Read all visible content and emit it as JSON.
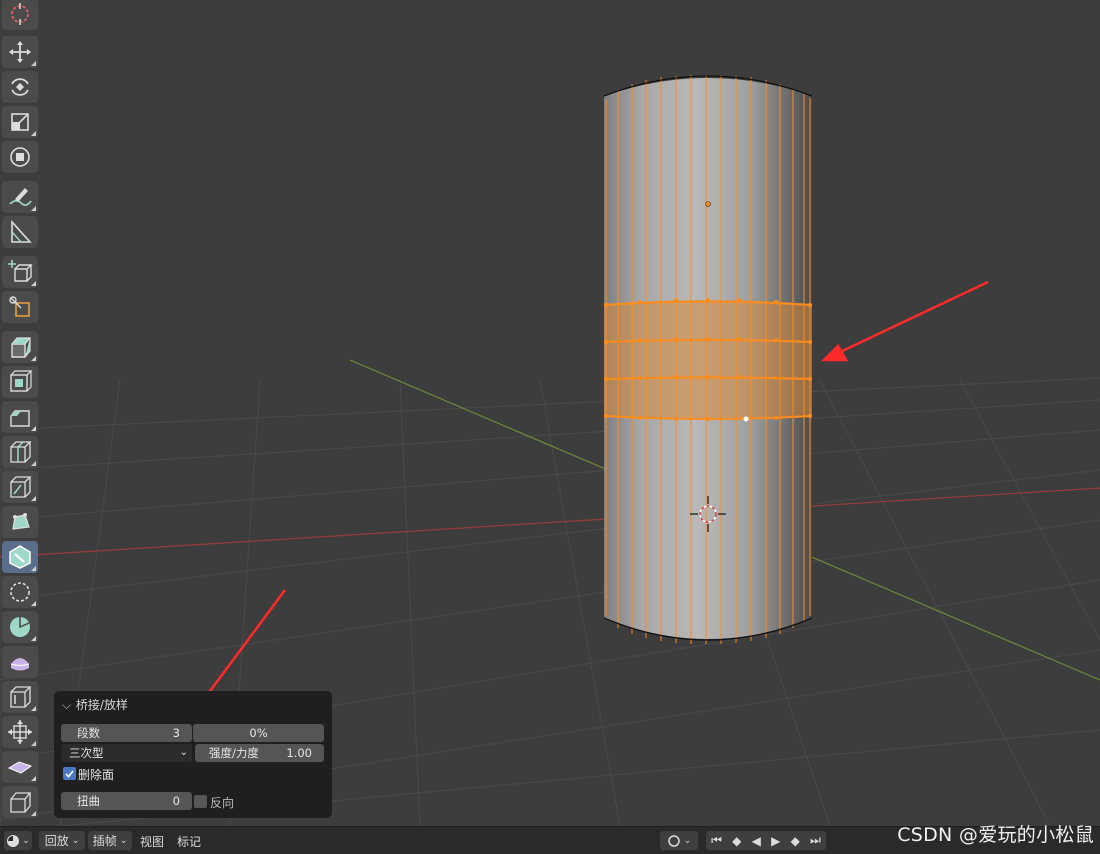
{
  "operator_panel": {
    "title": "桥接/放样",
    "segments_label": "段数",
    "segments_value": "3",
    "profile_factor_value": "0%",
    "interpolation_value": "三次型",
    "smoothness_label": "强度/力度",
    "smoothness_value": "1.00",
    "merge_label": "删除面",
    "merge_checked": true,
    "twist_label": "扭曲",
    "twist_value": "0",
    "reverse_label": "反向",
    "reverse_checked": false
  },
  "timeline": {
    "playback_label": "回放",
    "keying_label": "插帧",
    "view_label": "视图",
    "marker_label": "标记"
  },
  "watermark": "CSDN @爱玩的小松鼠",
  "colors": {
    "background": "#3d3d3d",
    "selection_orange": "#ff8c1a",
    "annotation_arrow": "#ff2a2a",
    "x_axis": "#9a3c3c",
    "y_axis": "#6e8a3a",
    "panel_bg": "#1f1f1f",
    "checkbox_blue": "#4a78c7"
  },
  "icons": {
    "toolbar": [
      "cursor-icon",
      "move-icon",
      "rotate-icon",
      "scale-icon",
      "transform-icon",
      "annotate-icon",
      "measure-icon",
      "add-cube-icon",
      "extrude-icon",
      "extrude-region-icon",
      "inset-icon",
      "bevel-icon",
      "loop-cut-icon",
      "knife-icon",
      "poly-build-icon",
      "spin-icon",
      "smooth-icon",
      "randomize-icon",
      "edge-slide-icon",
      "shrink-fatten-icon",
      "shear-icon",
      "rip-icon"
    ]
  }
}
